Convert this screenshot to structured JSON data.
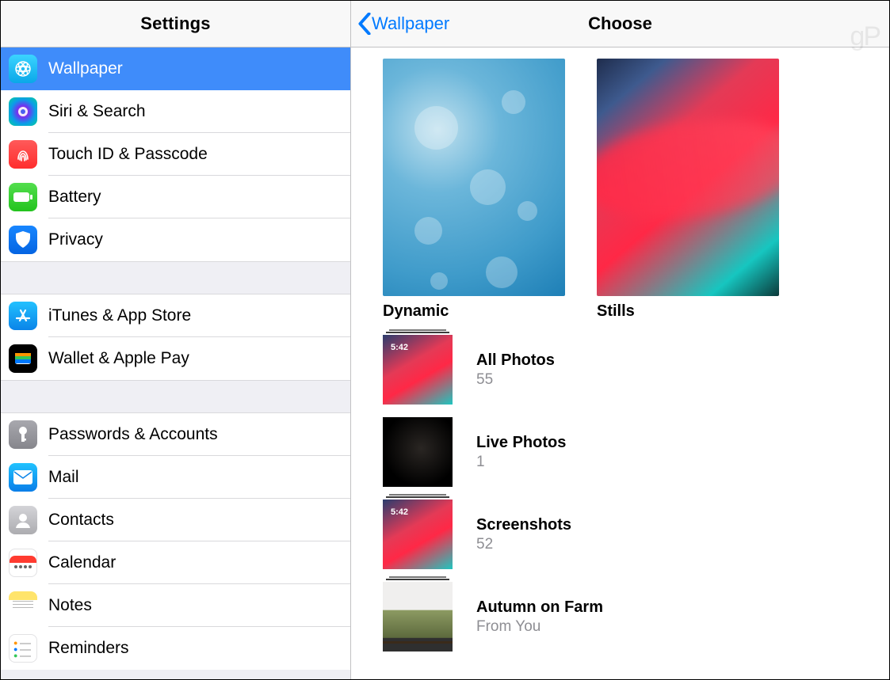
{
  "sidebar": {
    "title": "Settings",
    "groups": [
      {
        "items": [
          {
            "id": "wallpaper",
            "label": "Wallpaper",
            "icon": "ic-wallpaper",
            "interact": true,
            "selected": true
          },
          {
            "id": "siri-search",
            "label": "Siri & Search",
            "icon": "ic-siri",
            "interact": true
          },
          {
            "id": "touchid",
            "label": "Touch ID & Passcode",
            "icon": "ic-touchid",
            "interact": true
          },
          {
            "id": "battery",
            "label": "Battery",
            "icon": "ic-battery",
            "interact": true
          },
          {
            "id": "privacy",
            "label": "Privacy",
            "icon": "ic-privacy",
            "interact": true
          }
        ]
      },
      {
        "items": [
          {
            "id": "itunes-appstore",
            "label": "iTunes & App Store",
            "icon": "ic-appstore",
            "interact": true
          },
          {
            "id": "wallet-applepay",
            "label": "Wallet & Apple Pay",
            "icon": "ic-wallet",
            "interact": true
          }
        ]
      },
      {
        "items": [
          {
            "id": "passwords-accounts",
            "label": "Passwords & Accounts",
            "icon": "ic-passwords",
            "interact": true
          },
          {
            "id": "mail",
            "label": "Mail",
            "icon": "ic-mail",
            "interact": true
          },
          {
            "id": "contacts",
            "label": "Contacts",
            "icon": "ic-contacts",
            "interact": true
          },
          {
            "id": "calendar",
            "label": "Calendar",
            "icon": "ic-calendar",
            "interact": true
          },
          {
            "id": "notes",
            "label": "Notes",
            "icon": "ic-notes",
            "interact": true
          },
          {
            "id": "reminders",
            "label": "Reminders",
            "icon": "ic-reminders",
            "interact": true
          }
        ]
      }
    ]
  },
  "main": {
    "back_label": "Wallpaper",
    "title": "Choose",
    "categories": [
      {
        "id": "dynamic",
        "label": "Dynamic",
        "thumb": "dynamic"
      },
      {
        "id": "stills",
        "label": "Stills",
        "thumb": "stills"
      }
    ],
    "albums": [
      {
        "id": "all-photos",
        "title": "All Photos",
        "subtitle": "55",
        "thumb": "screenshot",
        "stack": true,
        "time_overlay": "5:42"
      },
      {
        "id": "live-photos",
        "title": "Live Photos",
        "subtitle": "1",
        "thumb": "black",
        "stack": false
      },
      {
        "id": "screenshots",
        "title": "Screenshots",
        "subtitle": "52",
        "thumb": "screenshot",
        "stack": true,
        "time_overlay": "5:42"
      },
      {
        "id": "autumn-on-farm",
        "title": "Autumn on Farm",
        "subtitle": "From You",
        "thumb": "farm",
        "stack": true
      }
    ]
  },
  "watermark": "gP"
}
